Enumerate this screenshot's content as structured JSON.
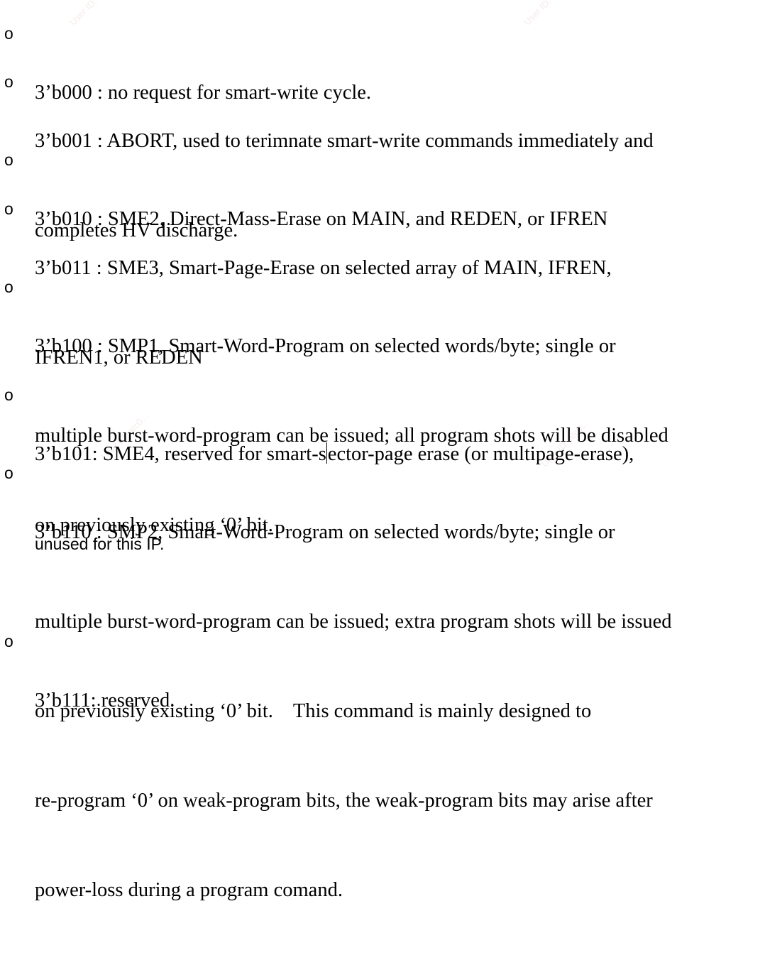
{
  "bullet_glyph": "o",
  "items": [
    {
      "lines": [
        "3’b000 : no request for smart-write cycle."
      ]
    },
    {
      "lines": [
        "3’b001 : ABORT, used to terimnate smart-write commands immediately and",
        "completes HV discharge."
      ]
    },
    {
      "lines": [
        "3’b010 : SME2, Direct-Mass-Erase on MAIN, and REDEN, or IFREN"
      ]
    },
    {
      "lines": [
        "3’b011 : SME3, Smart-Page-Erase on selected array of MAIN, IFREN,",
        "IFREN1, or REDEN"
      ]
    },
    {
      "lines": [
        "3’b100 : SMP1, Smart-Word-Program on selected words/byte; single or",
        "multiple burst-word-program can be issued; all program shots will be disabled",
        "on previously existing ‘0’ bit."
      ]
    },
    {
      "line1_before": "3’b101: SME4, reserved for smart-s",
      "line1_after": "ector-page erase (or multipage-erase),",
      "line2": "unused for this IP."
    },
    {
      "lines": [
        "3’b110 : SMP2, Smart-Word-Program on selected words/byte; single or",
        "multiple burst-word-program can be issued; extra program shots will be issued",
        "on previously existing ‘0’ bit.    This command is mainly designed to",
        "re-program ‘0’ on weak-program bits, the weak-program bits may arise after",
        "power-loss during a program comand."
      ]
    },
    {
      "lines": [
        "3’b111: reserved."
      ]
    }
  ],
  "watermark": "User ID: atc0..."
}
